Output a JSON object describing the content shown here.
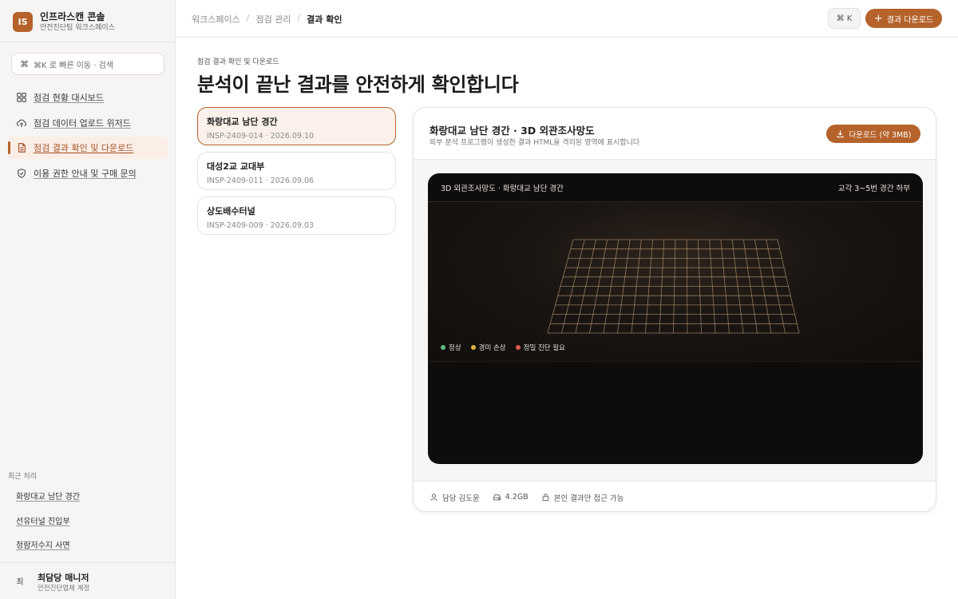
{
  "brand": {
    "initials": "IS",
    "name": "인프라스캔 콘솔",
    "workspace": "안전진단팀 워크스페이스"
  },
  "search": {
    "shortcut": "⌘",
    "placeholder": "⌘K 로 빠른 이동 · 검색"
  },
  "nav": [
    {
      "label": "점검 현황 대시보드",
      "icon": "grid-icon",
      "active": false
    },
    {
      "label": "점검 데이터 업로드 위저드",
      "icon": "cloud-upload-icon",
      "active": false
    },
    {
      "label": "점검 결과 확인 및 다운로드",
      "icon": "document-icon",
      "active": true
    },
    {
      "label": "이용 권한 안내 및 구매 문의",
      "icon": "shield-icon",
      "active": false
    }
  ],
  "recent": {
    "title": "최근 처리",
    "items": [
      "화랑대교 남단 경간",
      "선유터널 진입부",
      "청람저수지 사면"
    ]
  },
  "user": {
    "avatar": "최",
    "name": "최담당 매니저",
    "role": "안전진단업체 계정"
  },
  "header": {
    "breadcrumbs": [
      "워크스페이스",
      "점검 관리",
      "결과 확인"
    ],
    "shortcut_button": "⌘ K",
    "download_button": "결과 다운로드"
  },
  "page": {
    "eyebrow": "점검 결과 확인 및 다운로드",
    "title": "분석이 끝난 결과를 안전하게 확인합니다"
  },
  "inspections": [
    {
      "name": "화랑대교 남단 경간",
      "meta": "INSP-2409-014 · 2026.09.10",
      "active": true
    },
    {
      "name": "대성2교 교대부",
      "meta": "INSP-2409-011 · 2026.09.06",
      "active": false
    },
    {
      "name": "상도배수터널",
      "meta": "INSP-2409-009 · 2026.09.03",
      "active": false
    }
  ],
  "result": {
    "title": "화랑대교 남단 경간 · 3D 외관조사망도",
    "subtitle": "외부 분석 프로그램이 생성한 결과 HTML을 격리된 영역에 표시합니다",
    "download_label": "다운로드 (약 3MB)",
    "viewer_title": "3D 외관조사망도 · 화랑대교 남단 경간",
    "viewer_location": "교각 3~5번 경간 하부",
    "legend": [
      {
        "label": "정상",
        "color": "#5fbf83"
      },
      {
        "label": "경미 손상",
        "color": "#e2b33f"
      },
      {
        "label": "정밀 진단 필요",
        "color": "#e0574f"
      }
    ],
    "footer": {
      "owner": "담당 김도윤",
      "size": "4.2GB",
      "access": "본인 결과만 접근 가능"
    }
  },
  "colors": {
    "accent": "#b5622b",
    "viewer_bg": "#0f0d0c"
  }
}
